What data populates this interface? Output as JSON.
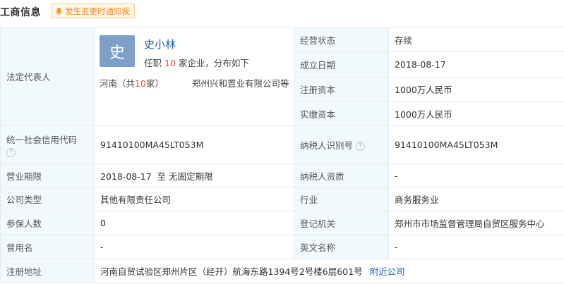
{
  "header": {
    "title": "工商信息",
    "notify_label": "发生变更时通知我",
    "notify_icon": "bell-icon"
  },
  "legal_rep": {
    "label": "法定代表人",
    "avatar_char": "史",
    "name": "史小林",
    "sub_prefix": "任职",
    "sub_count": "10",
    "sub_suffix": "家企业，分布如下",
    "region_prefix": "河南（共",
    "region_count": "10",
    "region_suffix": "家）",
    "region_company": "郑州兴和置业有限公司等"
  },
  "right_top": [
    {
      "label": "经营状态",
      "value": "存续"
    },
    {
      "label": "成立日期",
      "value": "2018-08-17"
    },
    {
      "label": "注册资本",
      "value": "1000万人民币"
    },
    {
      "label": "实缴资本",
      "value": "1000万人民币"
    }
  ],
  "credit_code": {
    "label": "统一社会信用代码",
    "value": "91410100MA45LT053M",
    "help_icon": "?"
  },
  "taxpayer_id": {
    "label": "纳税人识别号",
    "value": "91410100MA45LT053M",
    "help_icon": "?"
  },
  "business_term": {
    "label": "营业期限",
    "value": "2018-08-17  至 无固定期限"
  },
  "taxpayer_qual": {
    "label": "纳税人资质",
    "value": "-"
  },
  "company_type": {
    "label": "公司类型",
    "value": "其他有限责任公司"
  },
  "industry": {
    "label": "行业",
    "value": "商务服务业"
  },
  "insured": {
    "label": "参保人数",
    "value": "0"
  },
  "authority": {
    "label": "登记机关",
    "value": "郑州市市场监督管理局自贸区服务中心"
  },
  "former_name": {
    "label": "曾用名",
    "value": "-"
  },
  "english_name": {
    "label": "英文名称",
    "value": "-"
  },
  "address": {
    "label": "注册地址",
    "value": "河南自贸试验区郑州片区（经开）航海东路1394号2号楼6层601号",
    "link": "附近公司"
  },
  "colors": {
    "label_bg": "#f2f9fc",
    "border": "#e4eaf2",
    "link": "#1a63b8",
    "highlight": "#e64a3b",
    "notify": "#f08a24",
    "avatar_bg": "#7da0c9"
  }
}
